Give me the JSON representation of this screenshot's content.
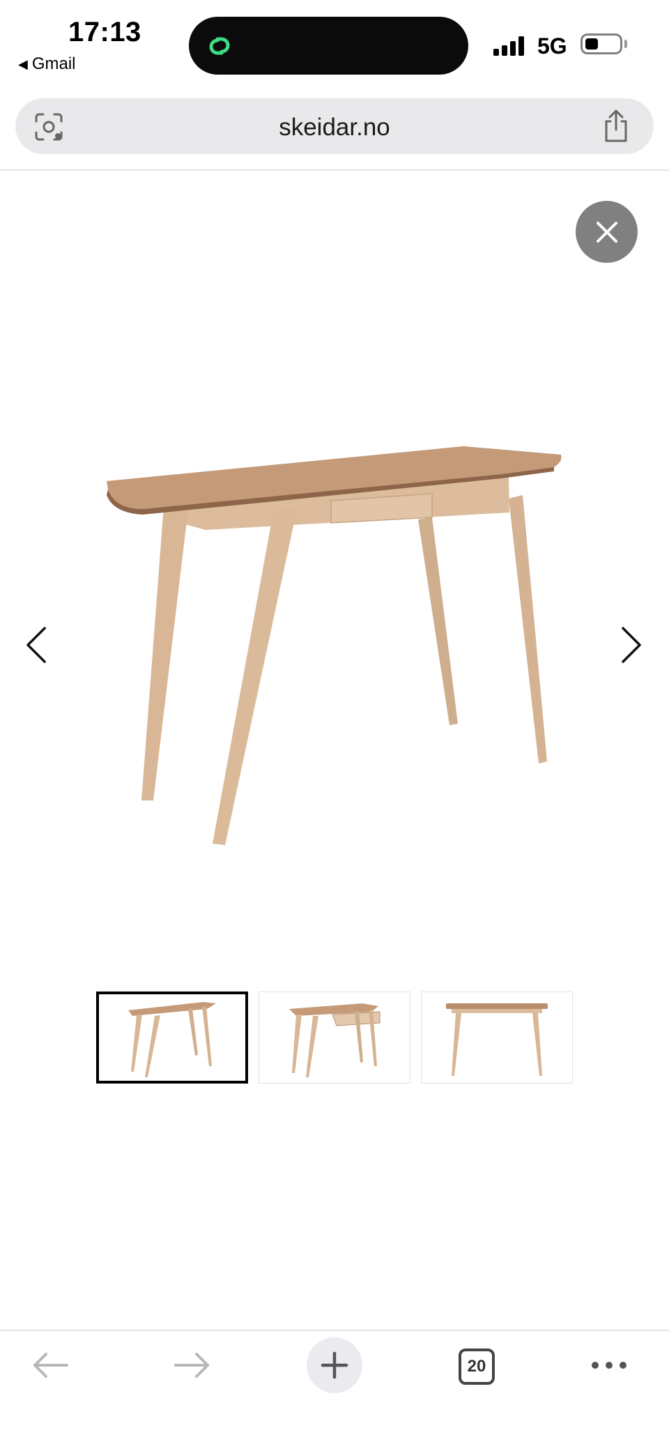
{
  "status_bar": {
    "time": "17:13",
    "back_app": "Gmail",
    "network": "5G",
    "signal_bars": 4
  },
  "browser": {
    "url": "skeidar.no",
    "tabs_count": "20",
    "icons": {
      "lens": "camera-search-icon",
      "share": "share-icon",
      "back": "arrow-left-icon",
      "forward": "arrow-right-icon",
      "new_tab": "plus-icon",
      "more": "more-dots-icon"
    }
  },
  "gallery": {
    "product_image": "wooden-desk-photo",
    "thumbnails": [
      {
        "view": "desk-angle-view",
        "selected": true
      },
      {
        "view": "desk-drawer-open-view",
        "selected": false
      },
      {
        "view": "desk-front-view",
        "selected": false
      }
    ],
    "colors": {
      "wood": "#d8b898",
      "wood_top": "#b98c6a",
      "close_button": "#808080"
    }
  }
}
